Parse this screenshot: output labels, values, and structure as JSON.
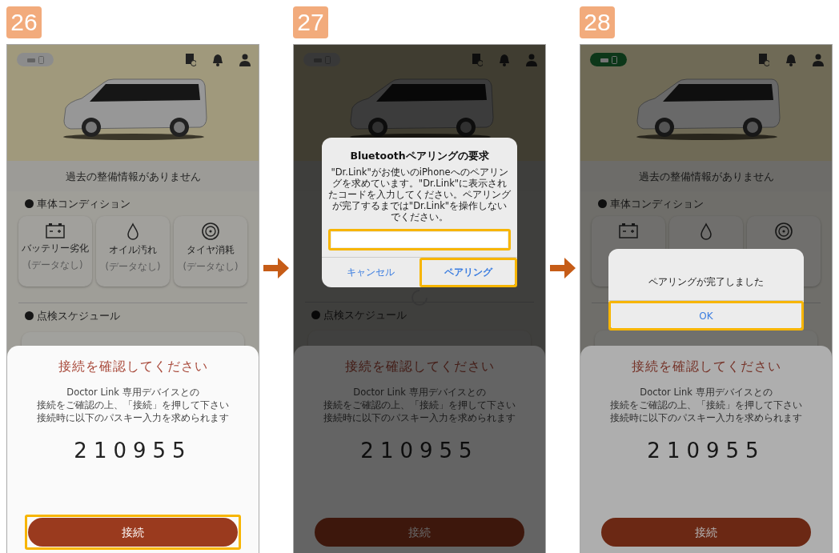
{
  "steps": [
    {
      "number": "26",
      "phone": {
        "connected": false,
        "no_history": "過去の整備情報がありません",
        "condition_title": "車体コンディション",
        "conditions": [
          {
            "kind": "battery",
            "label": "バッテリー劣化",
            "value": "(データなし)"
          },
          {
            "kind": "oil",
            "label": "オイル汚れ",
            "value": "(データなし)"
          },
          {
            "kind": "tire",
            "label": "タイヤ消耗",
            "value": "(データなし)"
          }
        ],
        "schedule_title": "点検スケジュール",
        "sheet": {
          "title": "接続を確認してください",
          "message": [
            "Doctor Link 専用デバイスとの",
            "接続をご確認の上、「接続」を押して下さい",
            "接続時に以下のパスキー入力を求められます"
          ],
          "passkey": "210955",
          "button": "接続",
          "button_highlighted": true
        }
      }
    },
    {
      "number": "27",
      "phone": {
        "connected": false,
        "schedule_title": "点検スケジュール",
        "loading": true,
        "sheet": {
          "title": "接続を確認してください",
          "message": [
            "Doctor Link 専用デバイスとの",
            "接続をご確認の上、「接続」を押して下さい",
            "接続時に以下のパスキー入力を求められます"
          ],
          "passkey": "210955",
          "button": "接続",
          "button_highlighted": false
        },
        "dialog": {
          "kind": "pairing_request",
          "title": "Bluetoothペアリングの要求",
          "message": "\"Dr.Link\"がお使いのiPhoneへのペアリングを求めています。\"Dr.Link\"に表示されたコードを入力してください。ペアリングが完了するまでは\"Dr.Link\"を操作しないでください。",
          "input_highlighted": true,
          "buttons": [
            {
              "label": "キャンセル",
              "bold": false,
              "highlighted": false
            },
            {
              "label": "ペアリング",
              "bold": true,
              "highlighted": true
            }
          ]
        }
      }
    },
    {
      "number": "28",
      "phone": {
        "connected": true,
        "no_history": "過去の整備情報がありません",
        "condition_title": "車体コンディション",
        "conditions": [
          {
            "kind": "battery"
          },
          {
            "kind": "oil"
          },
          {
            "kind": "tire"
          }
        ],
        "sheet": {
          "title": "接続を確認してください",
          "message": [
            "Doctor Link 専用デバイスとの",
            "接続をご確認の上、「接続」を押して下さい",
            "接続時に以下のパスキー入力を求められます"
          ],
          "passkey": "210955",
          "button": "接続",
          "button_highlighted": false
        },
        "dialog": {
          "kind": "alert",
          "message": "ペアリングが完了しました",
          "buttons": [
            {
              "label": "OK",
              "bold": false,
              "highlighted": true
            }
          ]
        }
      }
    }
  ]
}
